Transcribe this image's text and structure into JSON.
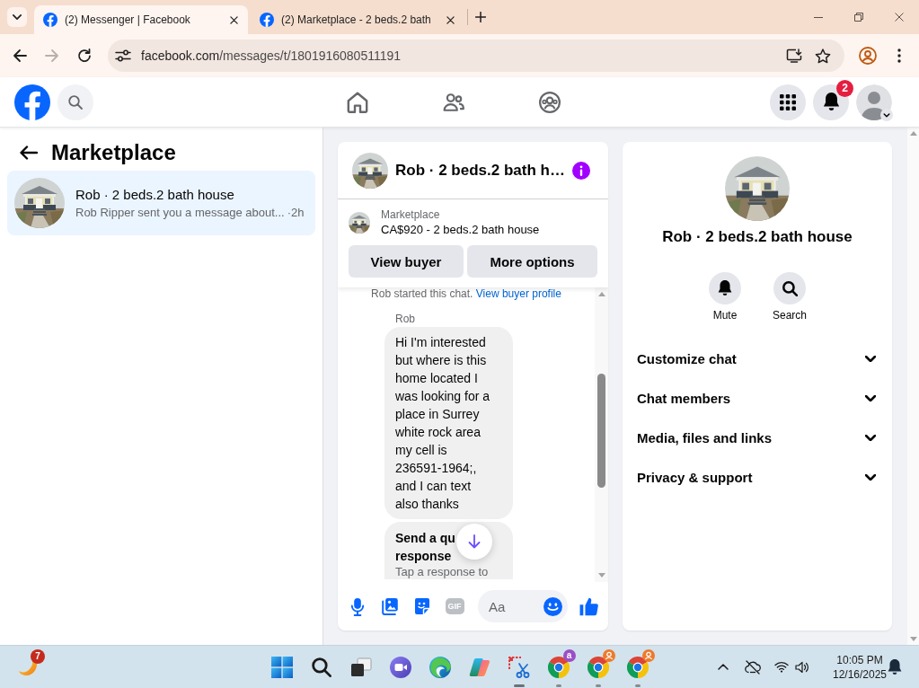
{
  "browser": {
    "tabs": [
      {
        "title": "(2) Messenger | Facebook",
        "selected": true
      },
      {
        "title": "(2) Marketplace - 2 beds.2 bath",
        "selected": false
      }
    ],
    "nav_buttons": [
      {
        "kind": "back",
        "disabled": false
      },
      {
        "kind": "forward",
        "disabled": true
      },
      {
        "kind": "reload",
        "disabled": false
      }
    ],
    "url": {
      "host": "facebook.com",
      "path": "/messages/t/1801916080511191"
    }
  },
  "header": {
    "nav": [
      {
        "kind": "home",
        "selected": false
      },
      {
        "kind": "friends",
        "selected": false
      },
      {
        "kind": "groups",
        "selected": false
      }
    ],
    "notification_count": "2"
  },
  "sidebar": {
    "title": "Marketplace",
    "conversations": [
      {
        "name": "Rob · 2 beds.2 bath house",
        "preview": "Rob Ripper sent you a message about...",
        "time": "·2h",
        "selected": true
      }
    ]
  },
  "chat": {
    "title": "Rob · 2 beds.2 bath h…",
    "listing": {
      "source": "Marketplace",
      "title": "CA$920 - 2 beds.2 bath house"
    },
    "buttons": [
      "View buyer",
      "More options"
    ],
    "note": {
      "text": "Rob started this chat.",
      "link": "View buyer profile"
    },
    "messages": [
      {
        "kind": "text",
        "sender": "Rob",
        "lines": [
          "Hi I'm interested",
          "but where is this",
          "home located I",
          "was looking for a",
          "place in Surrey",
          "white rock area",
          "my cell is",
          "236591-1964;,",
          "and I can text",
          "also thanks"
        ]
      },
      {
        "kind": "quick_reply",
        "title_lines": [
          "Send a qu",
          "response"
        ],
        "subtitle": "Tap a response to"
      }
    ],
    "composer": {
      "tools": [
        {
          "kind": "mic"
        },
        {
          "kind": "photo"
        },
        {
          "kind": "sticker"
        },
        {
          "kind": "gif",
          "label": "GIF"
        }
      ],
      "placeholder": "Aa"
    }
  },
  "details": {
    "title": "Rob · 2 beds.2 bath house",
    "actions": [
      {
        "kind": "mute",
        "label": "Mute"
      },
      {
        "kind": "search",
        "label": "Search"
      }
    ],
    "sections": [
      {
        "label": "Customize chat",
        "expanded": false
      },
      {
        "label": "Chat members",
        "expanded": false
      },
      {
        "label": "Media, files and links",
        "expanded": false
      },
      {
        "label": "Privacy & support",
        "expanded": false
      }
    ]
  },
  "taskbar": {
    "widget_badge": "7",
    "apps": [
      {
        "kind": "start",
        "running": false,
        "focused": false
      },
      {
        "kind": "search",
        "running": false,
        "focused": false
      },
      {
        "kind": "task_view",
        "running": false,
        "focused": false
      },
      {
        "kind": "meet",
        "running": false,
        "focused": false
      },
      {
        "kind": "edge",
        "running": false,
        "focused": false
      },
      {
        "kind": "copilot",
        "running": false,
        "focused": false
      },
      {
        "kind": "snipping",
        "running": true,
        "focused": true
      },
      {
        "kind": "chrome",
        "running": true,
        "focused": false,
        "badge": {
          "kind": "letter",
          "text": "a"
        }
      },
      {
        "kind": "chrome",
        "running": true,
        "focused": false,
        "badge": {
          "kind": "person"
        }
      },
      {
        "kind": "chrome",
        "running": true,
        "focused": false,
        "badge": {
          "kind": "person"
        }
      }
    ],
    "clock": {
      "time": "10:05 PM",
      "date": "12/16/2025"
    }
  }
}
